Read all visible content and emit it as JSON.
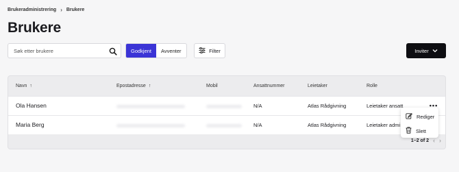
{
  "breadcrumb": {
    "parent": "Brukeradministrering",
    "separator": "›",
    "current": "Brukere"
  },
  "page": {
    "title": "Brukere"
  },
  "search": {
    "placeholder": "Søk etter brukere",
    "value": "",
    "icon": "search-icon"
  },
  "status_filter": {
    "options": [
      {
        "label": "Godkjent",
        "active": true
      },
      {
        "label": "Avventer",
        "active": false
      }
    ],
    "accent_color": "#3b34d6"
  },
  "filter_button": {
    "label": "Filter",
    "icon": "sliders-icon"
  },
  "invite_button": {
    "label": "Inviter",
    "icon": "chevron-down-icon"
  },
  "table": {
    "columns": [
      {
        "label": "Navn",
        "sort": "↑"
      },
      {
        "label": "Epostadresse",
        "sort": "↑"
      },
      {
        "label": "Mobil",
        "sort": ""
      },
      {
        "label": "Ansattnummer",
        "sort": ""
      },
      {
        "label": "Leietaker",
        "sort": ""
      },
      {
        "label": "Rolle",
        "sort": ""
      }
    ],
    "rows": [
      {
        "name": "Ola Hansen",
        "email": "",
        "mobile": "",
        "employee_no": "N/A",
        "tenant": "Atlas Rådgivning",
        "role": "Leietaker ansatt"
      },
      {
        "name": "Maria Berg",
        "email": "",
        "mobile": "",
        "employee_no": "N/A",
        "tenant": "Atlas Rådgivning",
        "role": "Leietaker admi"
      }
    ],
    "more_label": "•••"
  },
  "pagination": {
    "range": "1–2 of 2",
    "prev": "‹",
    "next": "›"
  },
  "row_menu": {
    "items": [
      {
        "label": "Rediger",
        "icon": "edit-icon"
      },
      {
        "label": "Slett",
        "icon": "trash-icon"
      }
    ]
  }
}
